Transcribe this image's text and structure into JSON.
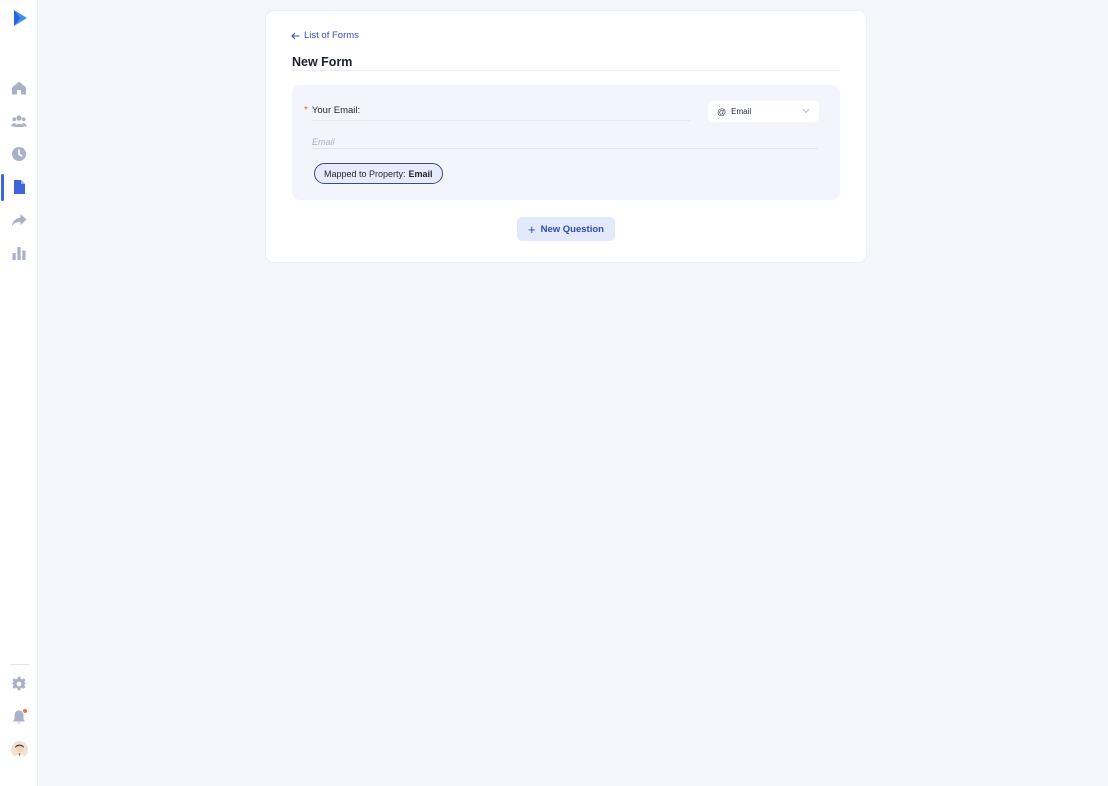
{
  "sidebar": {
    "nav_items": [
      {
        "name": "home-icon"
      },
      {
        "name": "users-icon"
      },
      {
        "name": "clock-icon"
      },
      {
        "name": "document-icon",
        "active": true
      },
      {
        "name": "share-icon"
      },
      {
        "name": "bar-chart-icon"
      }
    ],
    "bottom_items": [
      {
        "name": "gear-icon"
      },
      {
        "name": "bell-icon",
        "has_notification": true
      },
      {
        "name": "avatar"
      }
    ]
  },
  "colors": {
    "accent": "#3f63d8",
    "link": "#2f4eb5",
    "required": "#ee5d3c",
    "notification": "#f26b4a",
    "background": "#f5f6fc"
  },
  "header": {
    "back_link_label": "List of Forms",
    "title": "New Form"
  },
  "question": {
    "required_mark": "*",
    "label": "Your Email:",
    "type_select": {
      "icon_glyph": "@",
      "selected": "Email"
    },
    "answer_placeholder": "Email",
    "mapped": {
      "prefix": "Mapped to Property:",
      "property": "Email"
    }
  },
  "actions": {
    "new_question_label": "New Question"
  }
}
